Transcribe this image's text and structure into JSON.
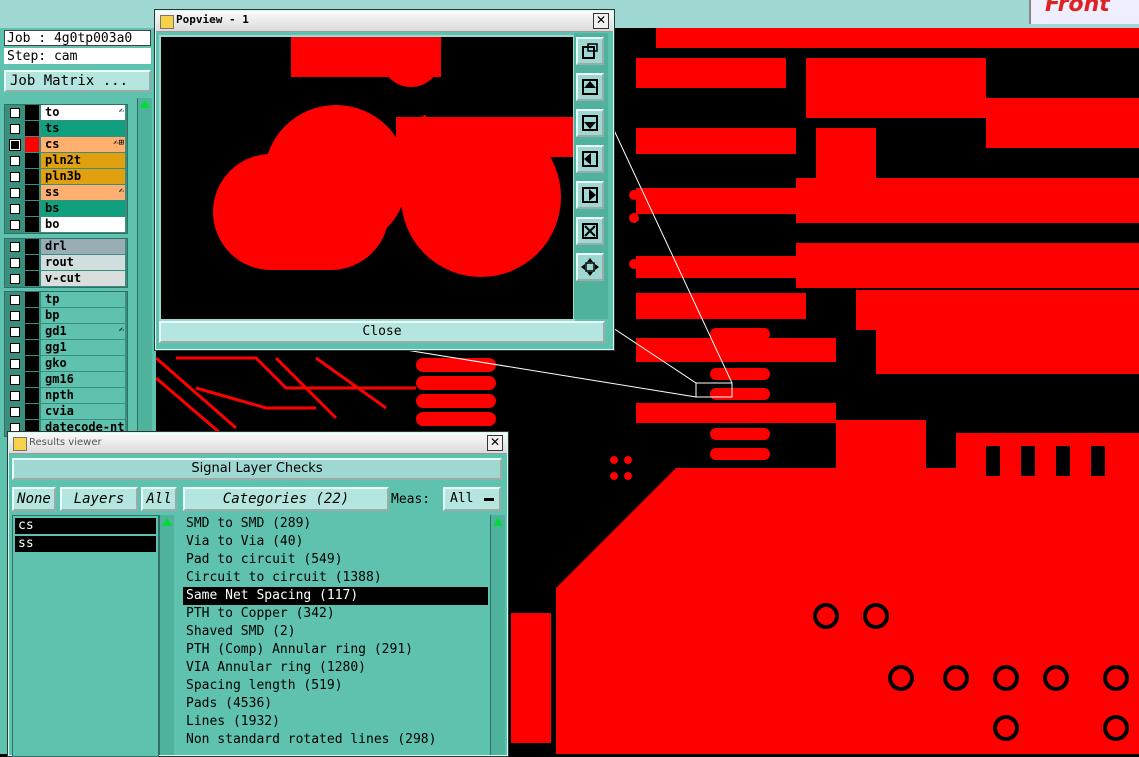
{
  "colors": {
    "teal": "#5fc2ae",
    "copper": "#ff0000",
    "background": "#000000"
  },
  "job_info": {
    "job": "Job : 4g0tp003a0",
    "step": "Step: cam"
  },
  "job_matrix_label": "Job Matrix ...",
  "layers_top": [
    {
      "name": "to",
      "color": "#ffffff",
      "flag": "✍"
    },
    {
      "name": "ts",
      "color": "#10a080",
      "flag": ""
    },
    {
      "name": "cs",
      "color": "#ffb070",
      "flag": "✍⊞",
      "active": true
    },
    {
      "name": "pln2t",
      "color": "#e0a010",
      "flag": ""
    },
    {
      "name": "pln3b",
      "color": "#e0a010",
      "flag": ""
    },
    {
      "name": "ss",
      "color": "#ffb070",
      "flag": "✍"
    },
    {
      "name": "bs",
      "color": "#10a080",
      "flag": ""
    },
    {
      "name": "bo",
      "color": "#ffffff",
      "flag": ""
    }
  ],
  "layers_drill": [
    {
      "name": "drl",
      "color": "#98aeb4"
    },
    {
      "name": "rout",
      "color": "#d0dede"
    },
    {
      "name": "v-cut",
      "color": "#d8dede"
    }
  ],
  "layers_doc": [
    {
      "name": "tp",
      "color": "#5fc2ae",
      "flag": ""
    },
    {
      "name": "bp",
      "color": "#5fc2ae",
      "flag": ""
    },
    {
      "name": "gd1",
      "color": "#5fc2ae",
      "flag": "✍"
    },
    {
      "name": "gg1",
      "color": "#5fc2ae",
      "flag": ""
    },
    {
      "name": "gko",
      "color": "#5fc2ae",
      "flag": ""
    },
    {
      "name": "gm16",
      "color": "#5fc2ae",
      "flag": ""
    },
    {
      "name": "npth",
      "color": "#5fc2ae",
      "flag": ""
    },
    {
      "name": "cvia",
      "color": "#5fc2ae",
      "flag": ""
    },
    {
      "name": "datecode-nt",
      "color": "#5fc2ae",
      "flag": ""
    }
  ],
  "popview": {
    "title": "Popview - 1",
    "close_label": "Close"
  },
  "results_viewer": {
    "title": "Results viewer",
    "header": "Signal Layer Checks",
    "none_label": "None",
    "layers_label": "Layers",
    "all_label": "All",
    "categories_label": "Categories (22)",
    "meas_label": "Meas:",
    "meas_value": "All",
    "layers": [
      "cs",
      "ss"
    ],
    "categories": [
      "SMD to SMD (289)",
      "Via to Via (40)",
      "Pad to circuit (549)",
      "Circuit to circuit (1388)",
      "Same Net Spacing (117)",
      "PTH to Copper (342)",
      "Shaved SMD (2)",
      "PTH (Comp) Annular ring (291)",
      "VIA Annular ring (1280)",
      "Spacing length (519)",
      "Pads (4536)",
      "Lines (1932)",
      "Non standard rotated lines (298)"
    ],
    "selected_category": "Same Net Spacing (117)"
  }
}
